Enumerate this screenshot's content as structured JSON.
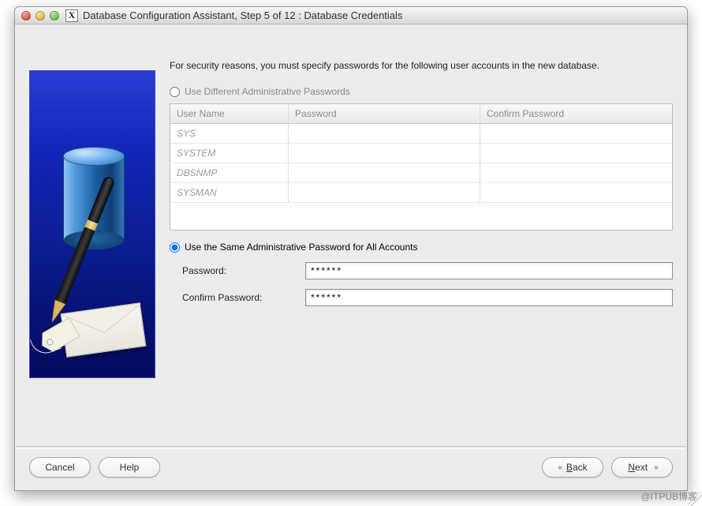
{
  "window": {
    "title": "Database Configuration Assistant, Step 5 of 12 : Database Credentials",
    "app_icon_label": "X"
  },
  "intro": "For security reasons, you must specify passwords for the following user accounts in the new database.",
  "options": {
    "different": {
      "label": "Use Different Administrative Passwords",
      "selected": false
    },
    "same": {
      "label": "Use the Same Administrative Password for All Accounts",
      "selected": true
    }
  },
  "table": {
    "headers": {
      "user": "User Name",
      "password": "Password",
      "confirm": "Confirm Password"
    },
    "rows": [
      {
        "user": "SYS",
        "password": "",
        "confirm": ""
      },
      {
        "user": "SYSTEM",
        "password": "",
        "confirm": ""
      },
      {
        "user": "DBSNMP",
        "password": "",
        "confirm": ""
      },
      {
        "user": "SYSMAN",
        "password": "",
        "confirm": ""
      }
    ]
  },
  "fields": {
    "password": {
      "label": "Password:",
      "value": "******"
    },
    "confirm": {
      "label": "Confirm Password:",
      "value": "******"
    }
  },
  "buttons": {
    "cancel": "Cancel",
    "help": "Help",
    "back": "Back",
    "next": "Next",
    "back_u": "B",
    "back_rest": "ack",
    "next_u": "N",
    "next_rest": "ext"
  },
  "watermark": "@ITPUB博客"
}
